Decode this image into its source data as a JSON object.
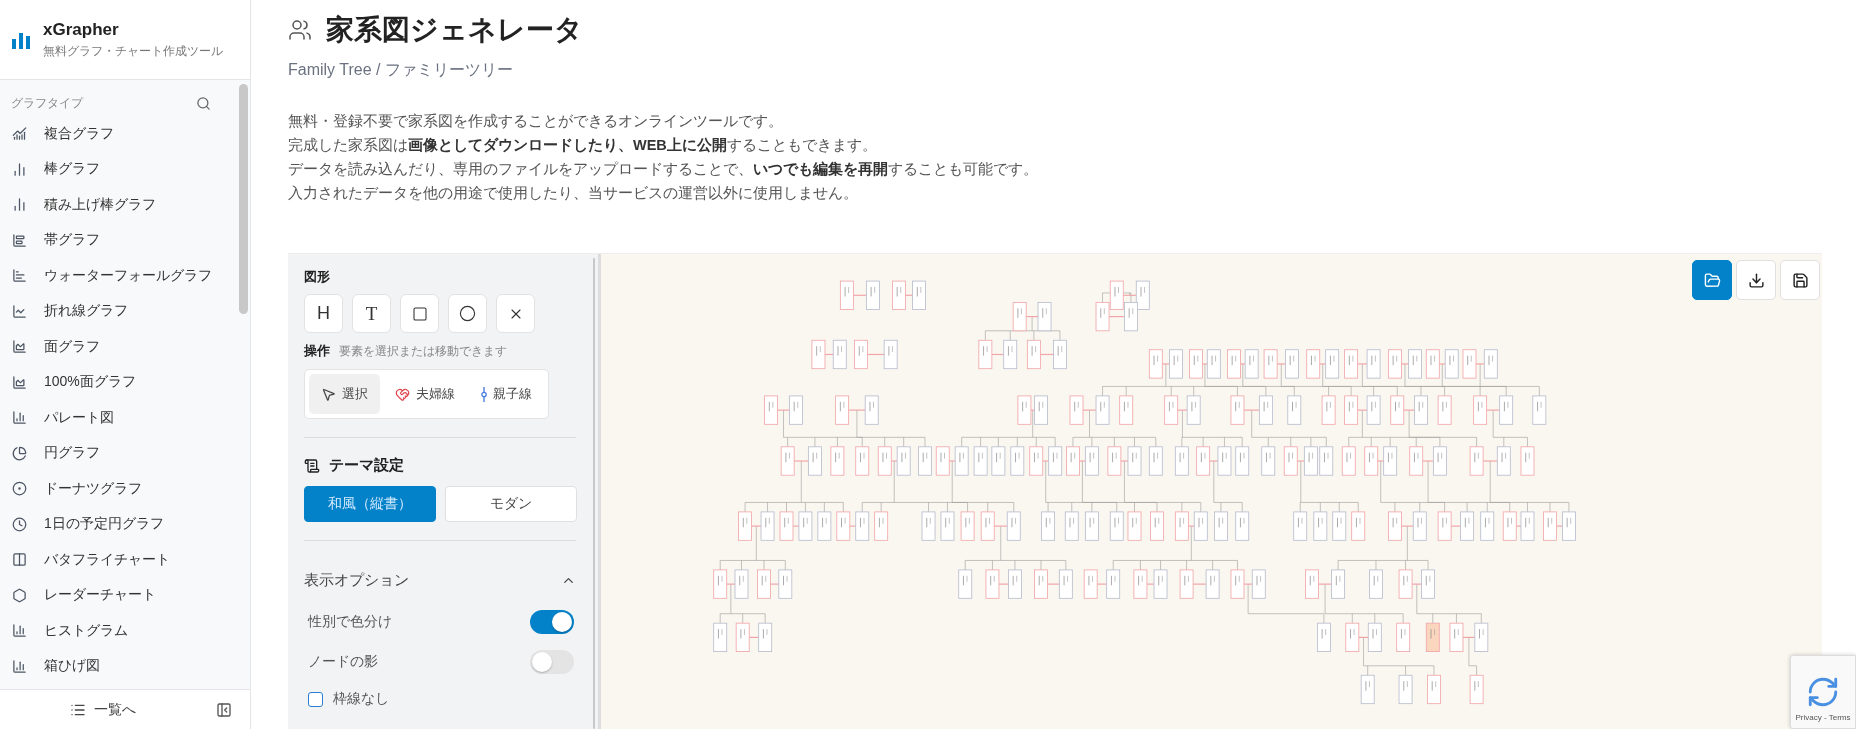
{
  "app": {
    "name": "xGrapher",
    "tagline": "無料グラフ・チャート作成ツール"
  },
  "sidebar": {
    "heading": "グラフタイプ",
    "items": [
      {
        "label": "複合グラフ"
      },
      {
        "label": "棒グラフ"
      },
      {
        "label": "積み上げ棒グラフ"
      },
      {
        "label": "帯グラフ"
      },
      {
        "label": "ウォーターフォールグラフ"
      },
      {
        "label": "折れ線グラフ"
      },
      {
        "label": "面グラフ"
      },
      {
        "label": "100%面グラフ"
      },
      {
        "label": "パレート図"
      },
      {
        "label": "円グラフ"
      },
      {
        "label": "ドーナツグラフ"
      },
      {
        "label": "1日の予定円グラフ"
      },
      {
        "label": "バタフライチャート"
      },
      {
        "label": "レーダーチャート"
      },
      {
        "label": "ヒストグラム"
      },
      {
        "label": "箱ひげ図"
      }
    ],
    "footer": {
      "label": "一覧へ"
    }
  },
  "page": {
    "title": "家系図ジェネレータ",
    "subtitle": "Family Tree / ファミリーツリー",
    "description": [
      "無料・登録不要で家系図を作成することができるオンラインツールです。",
      "完成した家系図は**画像としてダウンロードしたり、WEB上に公開**することもできます。",
      "データを読み込んだり、専用のファイルをアップロードすることで、**いつでも編集を再開**することも可能です。",
      "入力されたデータを他の用途で使用したり、当サービスの運営以外に使用しません。"
    ]
  },
  "editor": {
    "shapes": {
      "heading": "図形",
      "tools": [
        {
          "kind": "letter",
          "label": "H"
        },
        {
          "kind": "letter",
          "label": "T"
        },
        {
          "kind": "rect"
        },
        {
          "kind": "circle"
        },
        {
          "kind": "delete"
        }
      ]
    },
    "operation": {
      "label": "操作",
      "hint": "要素を選択または移動できます",
      "modes": [
        {
          "kind": "select",
          "label": "選択",
          "selected": true
        },
        {
          "kind": "couple",
          "label": "夫婦線",
          "selected": false
        },
        {
          "kind": "parent",
          "label": "親子線",
          "selected": false
        }
      ]
    },
    "theme": {
      "heading": "テーマ設定",
      "options": [
        {
          "label": "和風（縦書）",
          "selected": true
        },
        {
          "label": "モダン",
          "selected": false
        }
      ]
    },
    "display_options": {
      "heading": "表示オプション",
      "expanded": true,
      "toggles": [
        {
          "label": "性別で色分け",
          "on": true
        },
        {
          "label": "ノードの影",
          "on": false
        }
      ],
      "checkboxes": [
        {
          "label": "枠線なし",
          "checked": false
        }
      ]
    }
  },
  "canvas": {
    "actions": [
      {
        "kind": "open",
        "selected": true
      },
      {
        "kind": "download",
        "selected": false
      },
      {
        "kind": "save",
        "selected": false
      }
    ]
  },
  "recaptcha": {
    "text": "Privacy - Terms"
  }
}
